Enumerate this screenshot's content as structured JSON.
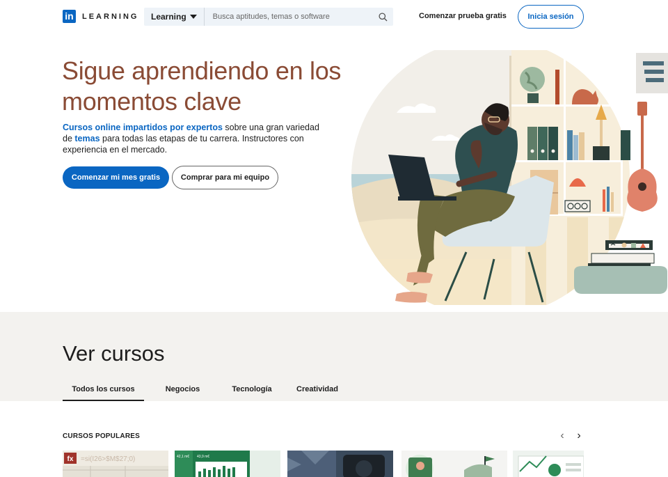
{
  "header": {
    "logo_mark": "in",
    "logo_text": "LEARNING",
    "search": {
      "dropdown_label": "Learning",
      "placeholder": "Busca aptitudes, temas o software"
    },
    "trial_link": "Comenzar prueba gratis",
    "signin_button": "Inicia sesión"
  },
  "hero": {
    "title_line1": "Sigue aprendiendo en los",
    "title_line2": "momentos clave",
    "desc_link1": "Cursos online impartidos por expertos",
    "desc_part1": " sobre una gran variedad de ",
    "desc_link2": "temas",
    "desc_part2": " para todas las etapas de tu carrera. Instructores con experiencia en el mercado.",
    "primary_button": "Comenzar mi mes gratis",
    "secondary_button": "Comprar para mi equipo"
  },
  "browse": {
    "title": "Ver cursos",
    "tabs": [
      {
        "label": "Todos los cursos"
      },
      {
        "label": "Negocios"
      },
      {
        "label": "Tecnología"
      },
      {
        "label": "Creatividad"
      }
    ]
  },
  "popular": {
    "title": "CURSOS POPULARES",
    "prev_glyph": "‹",
    "next_glyph": "›",
    "card1_fx": "fx",
    "card1_formula": "=si(I26>$M$27;0)",
    "card2_label_a": "42,1 m€",
    "card2_label_b": "43,9 m€"
  },
  "colors": {
    "brand_blue": "#0a66c2",
    "hero_title": "#8a4b35",
    "section_bg": "#f3f2ef"
  },
  "icons": [
    "search-icon",
    "chevron-left-icon",
    "chevron-right-icon",
    "caret-down-icon"
  ]
}
